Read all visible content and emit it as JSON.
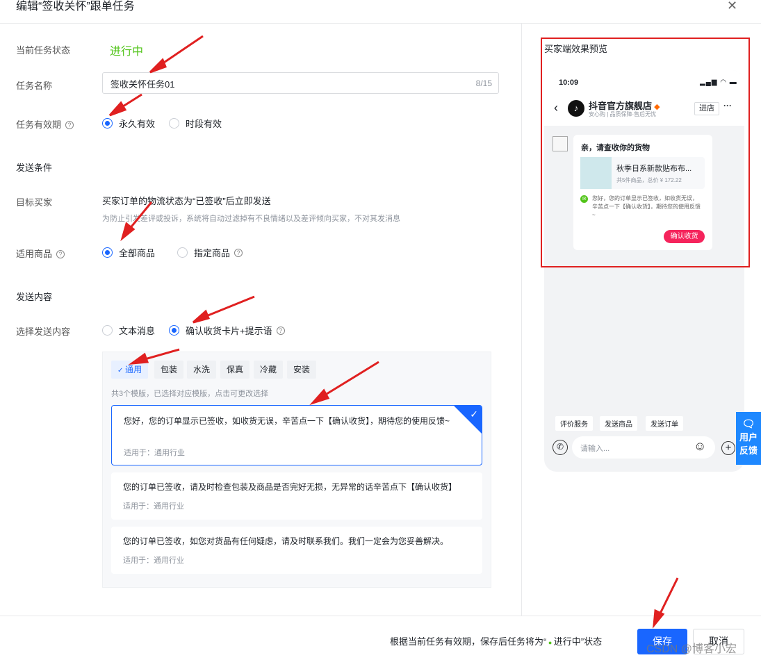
{
  "header": {
    "title": "编辑“签收关怀”跟单任务"
  },
  "form": {
    "status_label": "当前任务状态",
    "status_value": "进行中",
    "name_label": "任务名称",
    "name_value": "签收关怀任务01",
    "name_count": "8/15",
    "validity_label": "任务有效期",
    "validity_options": [
      "永久有效",
      "时段有效"
    ],
    "send_condition_section": "发送条件",
    "target_label": "目标买家",
    "target_text": "买家订单的物流状态为“已签收”后立即发送",
    "target_note": "为防止引发差评或投诉，系统将自动过滤掉有不良情绪以及差评倾向买家，不对其发消息",
    "product_label": "适用商品",
    "product_options": [
      "全部商品",
      "指定商品"
    ],
    "send_content_section": "发送内容",
    "content_label": "选择发送内容",
    "content_options": [
      "文本消息",
      "确认收货卡片+提示语"
    ]
  },
  "templates": {
    "tags": [
      "通用",
      "包装",
      "水洗",
      "保真",
      "冷藏",
      "安装"
    ],
    "hint": "共3个模版，已选择对应模版，点击可更改选择",
    "cards": [
      {
        "text": "您好，您的订单显示已签收，如收货无误，辛苦点一下【确认收货】，期待您的使用反馈~",
        "applies": "适用于：通用行业"
      },
      {
        "text": "您的订单已签收，请及时检查包装及商品是否完好无损，无异常的话辛苦点下【确认收货】",
        "applies": "适用于：通用行业"
      },
      {
        "text": "您的订单已签收，如您对货品有任何疑虑，请及时联系我们。我们一定会为您妥善解决。",
        "applies": "适用于：通用行业"
      }
    ]
  },
  "preview": {
    "title": "买家端效果预览",
    "time": "10:09",
    "shop_name": "抖音官方旗舰店",
    "shop_sub": "安心购 | 品质保障·售后无忧",
    "enter_shop": "进店",
    "more": "···",
    "card_title": "亲，请查收你的货物",
    "product_name": "秋季日系新款贴布布...",
    "product_meta": "共5件商品，总价 ¥ 172.22",
    "msg": "您好，您的订单显示已签收，如收货无误，辛苦点一下【确认收货】，期待您的使用反馈~",
    "confirm_btn": "确认收货",
    "quick_actions": [
      "评价服务",
      "发送商品",
      "发送订单"
    ],
    "input_placeholder": "请输入..."
  },
  "feedback": {
    "line1": "用户",
    "line2": "反馈"
  },
  "footer": {
    "notice_prefix": "根据当前任务有效期，保存后任务将为“",
    "notice_status": "进行中",
    "notice_suffix": "”状态",
    "save": "保存",
    "cancel": "取消",
    "watermark": "CSDN @博客小宏"
  },
  "colors": {
    "primary": "#1966ff",
    "success": "#52c41a",
    "danger": "#e02020",
    "shop_red": "#f5245c"
  }
}
